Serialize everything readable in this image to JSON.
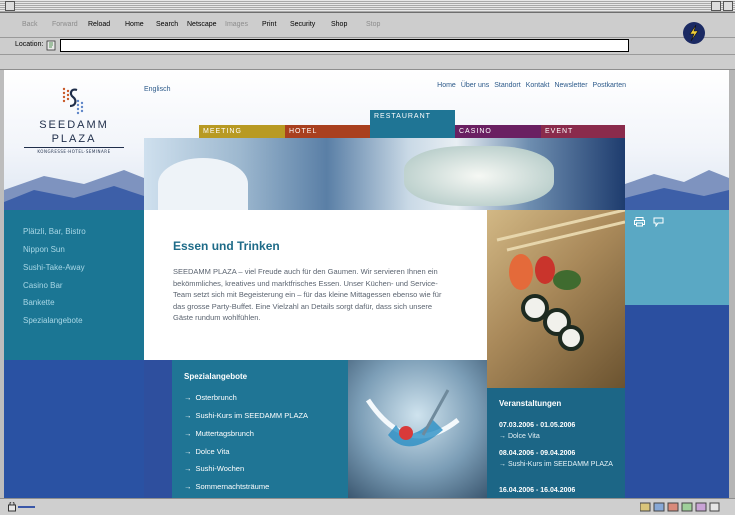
{
  "browser": {
    "toolbar": {
      "back": "Back",
      "forward": "Forward",
      "reload": "Reload",
      "home": "Home",
      "search": "Search",
      "netscape": "Netscape",
      "images": "Images",
      "print": "Print",
      "security": "Security",
      "shop": "Shop",
      "stop": "Stop"
    },
    "location_label": "Location:",
    "location_value": ""
  },
  "page": {
    "logo": {
      "line1": "SEEDAMM",
      "line2": "PLAZA",
      "line3": "KONGRESSE·HOTEL·SEMINARE"
    },
    "language_link": "Englisch",
    "top_nav": [
      "Home",
      "Über uns",
      "Standort",
      "Kontakt",
      "Newsletter",
      "Postkarten"
    ],
    "tabs": [
      {
        "label": "MEETING",
        "color": "#b89a23"
      },
      {
        "label": "HOTEL",
        "color": "#a9401f"
      },
      {
        "label": "RESTAURANT",
        "color": "#1f7595",
        "active": true
      },
      {
        "label": "CASINO",
        "color": "#6a2062"
      },
      {
        "label": "EVENT",
        "color": "#8a2b4c"
      }
    ],
    "sidebar": [
      "Plätzli, Bar, Bistro",
      "Nippon Sun",
      "Sushi-Take-Away",
      "Casino Bar",
      "Bankette",
      "Spezialangebote"
    ],
    "main": {
      "heading": "Essen und Trinken",
      "paragraph": "SEEDAMM PLAZA – viel Freude auch für den Gaumen. Wir servieren Ihnen ein bekömmliches, kreatives und marktfrisches Essen. Unser Küchen- und Service-Team setzt sich mit Begeisterung ein – für das kleine Mittagessen ebenso wie für das grosse Party-Buffet. Eine Vielzahl an Details sorgt dafür, dass sich unsere Gäste rundum wohlfühlen."
    },
    "specials": {
      "heading": "Spezialangebote",
      "items": [
        "Osterbrunch",
        "Sushi-Kurs im SEEDAMM PLAZA",
        "Muttertagsbrunch",
        "Dolce Vita",
        "Sushi-Wochen",
        "Sommernachtsträume"
      ]
    },
    "events": {
      "heading": "Veranstaltungen",
      "items": [
        {
          "date": "07.03.2006 - 01.05.2006",
          "title": "Dolce Vita"
        },
        {
          "date": "08.04.2006 - 09.04.2006",
          "title": "Sushi-Kurs im SEEDAMM PLAZA"
        },
        {
          "date": "16.04.2006 - 16.04.2006",
          "title": ""
        }
      ]
    }
  },
  "icons": [
    "print-icon",
    "chat-icon",
    "netscape-throbber-icon",
    "location-bookmark-icon"
  ]
}
